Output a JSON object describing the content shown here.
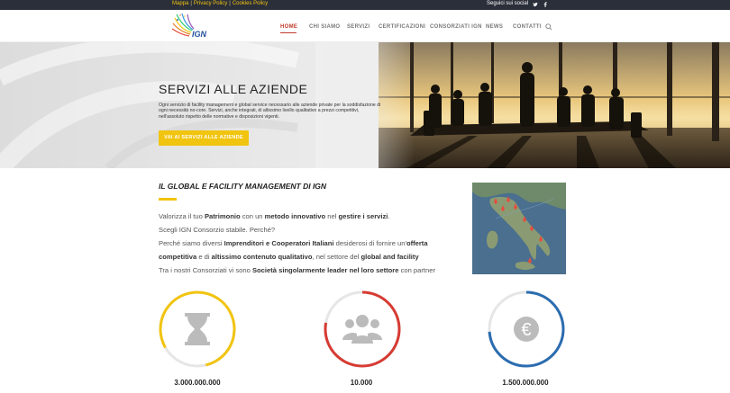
{
  "topbar": {
    "links": [
      "Mappa",
      "Privacy Policy",
      "Cookies Policy"
    ],
    "social_label": "Seguici sui social",
    "social_icons": [
      "twitter-icon",
      "facebook-icon"
    ]
  },
  "header": {
    "logo_text": "IGN",
    "nav": [
      "HOME",
      "CHI SIAMO",
      "SERVIZI",
      "CERTIFICAZIONI",
      "CONSORZIATI IGN",
      "NEWS",
      "CONTATTI"
    ],
    "active_nav": "HOME"
  },
  "hero": {
    "title": "SERVIZI ALLE AZIENDE",
    "text": "Ogni servizio di facility management e global service necessario alle aziende private per la soddisfazione di ogni necessità no-core. Servizi, anche integrati, di altissimo livello qualitativo a prezzi competitivi, nell'assoluto rispetto delle normative e disposizioni vigenti.",
    "button_label": "VAI AI SERVIZI ALLE AZIENDE"
  },
  "section": {
    "title": "IL GLOBAL E FACILITY MANAGEMENT DI IGN",
    "line1": {
      "a": "Valorizza il tuo ",
      "b": "Patrimonio",
      "c": " con un ",
      "d": "metodo innovativo",
      "e": " nel ",
      "f": "gestire i servizi",
      "g": "."
    },
    "line2": "Scegli IGN Consorzio stabile. Perché?",
    "line3": {
      "a": "Perché siamo diversi ",
      "b": "Imprenditori e Cooperatori Italiani",
      "c": " desiderosi di fornire un'",
      "d": "offerta"
    },
    "line4": {
      "a": "competitiva",
      "b": " e di ",
      "c": "altissimo contenuto qualitativo",
      "d": ", nel settore del ",
      "e": "global and facility"
    },
    "line5": {
      "a": "Tra i nostri Consorziati vi sono ",
      "b": "Società singolarmente leader nel loro settore",
      "c": " con partner"
    }
  },
  "counters": [
    {
      "icon": "hourglass-icon",
      "value": "3.000.000.000",
      "color": "#f1c40f"
    },
    {
      "icon": "users-icon",
      "value": "10.000",
      "color": "#d63b33"
    },
    {
      "icon": "euro-icon",
      "value": "1.500.000.000",
      "color": "#2b6cb0"
    }
  ]
}
